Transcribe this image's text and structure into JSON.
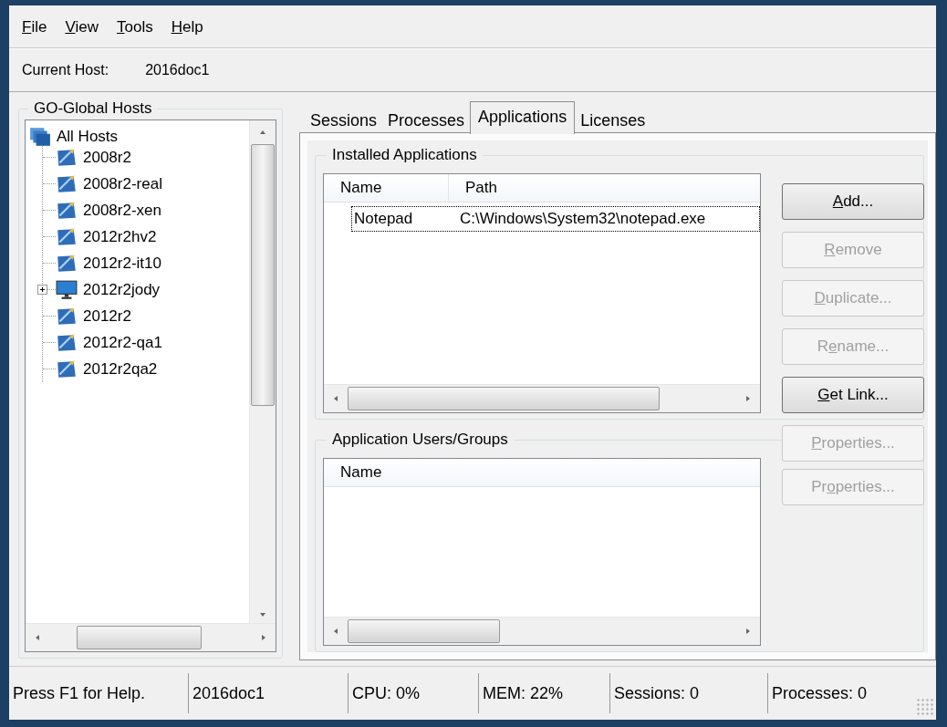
{
  "menu": [
    {
      "key": "F",
      "after": "ile"
    },
    {
      "key": "V",
      "after": "iew"
    },
    {
      "key": "T",
      "after": "ools"
    },
    {
      "key": "H",
      "after": "elp"
    }
  ],
  "current_host": {
    "label": "Current Host:",
    "value": "2016doc1"
  },
  "hosts_panel": {
    "title": "GO-Global Hosts",
    "tree": [
      {
        "label": "All Hosts",
        "kind": "group",
        "children": [
          {
            "label": "2008r2",
            "kind": "host"
          },
          {
            "label": "2008r2-real",
            "kind": "host"
          },
          {
            "label": "2008r2-xen",
            "kind": "host"
          },
          {
            "label": "2012r2hv2",
            "kind": "host"
          },
          {
            "label": "2012r2-it10",
            "kind": "host"
          },
          {
            "label": "2012r2jody",
            "kind": "monitor",
            "expanded": false
          },
          {
            "label": "2012r2",
            "kind": "host"
          },
          {
            "label": "2012r2-qa1",
            "kind": "host"
          },
          {
            "label": "2012r2qa2",
            "kind": "host"
          }
        ]
      }
    ]
  },
  "tabs": [
    {
      "label": "Sessions",
      "selected": false
    },
    {
      "label": "Processes",
      "selected": false
    },
    {
      "label": "Applications",
      "selected": true
    },
    {
      "label": "Licenses",
      "selected": false
    }
  ],
  "installed_applications": {
    "title": "Installed Applications",
    "columns": [
      "Name",
      "Path"
    ],
    "rows": [
      {
        "cells": [
          "Notepad",
          "C:\\Windows\\System32\\notepad.exe"
        ],
        "selected": true
      }
    ]
  },
  "application_users": {
    "title": "Application Users/Groups",
    "columns": [
      "Name"
    ]
  },
  "buttons": [
    {
      "key": "A",
      "after": "dd...",
      "disabled": false
    },
    {
      "key": "R",
      "after": "emove",
      "disabled": true
    },
    {
      "key": "D",
      "after": "uplicate...",
      "disabled": true
    },
    {
      "before": "R",
      "key": "e",
      "after": "name...",
      "disabled": true
    },
    {
      "key": "G",
      "after": "et Link...",
      "disabled": false
    },
    {
      "key": "P",
      "after": "roperties...",
      "disabled": true
    },
    {
      "before": "Pr",
      "key": "o",
      "after": "perties...",
      "disabled": true
    }
  ],
  "status_bar": [
    "Press F1 for Help.",
    "2016doc1",
    "CPU: 0%",
    "MEM: 22%",
    "Sessions: 0",
    "Processes: 0"
  ]
}
